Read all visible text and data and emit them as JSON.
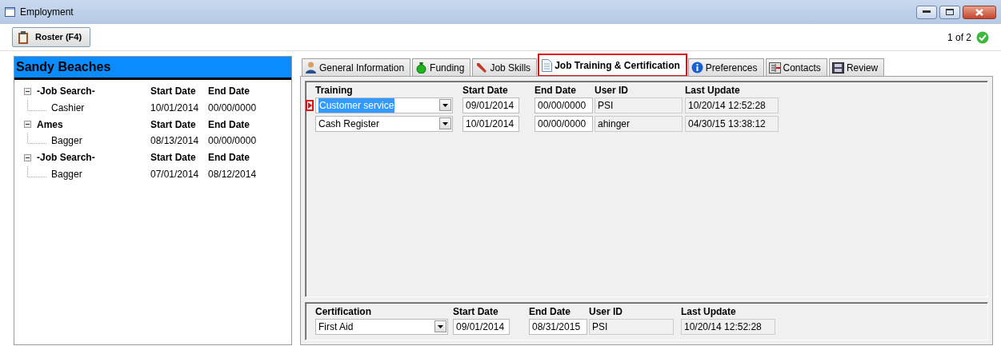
{
  "window": {
    "title": "Employment"
  },
  "toolbar": {
    "roster_button": "Roster (F4)",
    "record_counter": "1 of 2"
  },
  "client": {
    "name": "Sandy Beaches",
    "groups": [
      {
        "employer": "-Job Search-",
        "start_header": "Start Date",
        "end_header": "End Date",
        "expanded": true,
        "children": [
          {
            "job": "Cashier",
            "start_date": "10/01/2014",
            "end_date": "00/00/0000"
          }
        ]
      },
      {
        "employer": "Ames",
        "start_header": "Start Date",
        "end_header": "End Date",
        "expanded": true,
        "children": [
          {
            "job": "Bagger",
            "start_date": "08/13/2014",
            "end_date": "00/00/0000"
          }
        ]
      },
      {
        "employer": "-Job Search-",
        "start_header": "Start Date",
        "end_header": "End Date",
        "expanded": true,
        "children": [
          {
            "job": "Bagger",
            "start_date": "07/01/2014",
            "end_date": "08/12/2014"
          }
        ]
      }
    ]
  },
  "tabs": [
    {
      "label": "General Information",
      "selected": false
    },
    {
      "label": "Funding",
      "selected": false
    },
    {
      "label": "Job Skills",
      "selected": false
    },
    {
      "label": "Job Training & Certification",
      "selected": true
    },
    {
      "label": "Preferences",
      "selected": false
    },
    {
      "label": "Contacts",
      "selected": false
    },
    {
      "label": "Review",
      "selected": false
    }
  ],
  "training": {
    "columns": [
      "Training",
      "Start Date",
      "End Date",
      "User ID",
      "Last Update"
    ],
    "rows": [
      {
        "name": "Customer service",
        "start_date": "09/01/2014",
        "end_date": "00/00/0000",
        "user_id": "PSI",
        "last_update": "10/20/14 12:52:28",
        "selected": true
      },
      {
        "name": "Cash Register",
        "start_date": "10/01/2014",
        "end_date": "00/00/0000",
        "user_id": "ahinger",
        "last_update": "04/30/15 13:38:12",
        "selected": false
      }
    ]
  },
  "certification": {
    "columns": [
      "Certification",
      "Start Date",
      "End Date",
      "User ID",
      "Last Update"
    ],
    "rows": [
      {
        "name": "First Aid",
        "start_date": "09/01/2014",
        "end_date": "08/31/2015",
        "user_id": "PSI",
        "last_update": "10/20/14 12:52:28",
        "selected": false
      }
    ]
  }
}
